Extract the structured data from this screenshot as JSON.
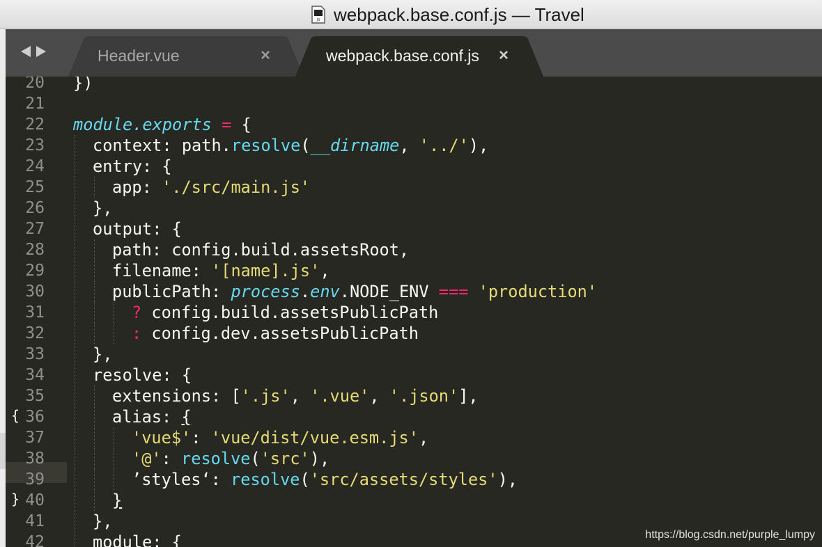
{
  "window": {
    "title": "webpack.base.conf.js — Travel"
  },
  "tabs": [
    {
      "label": "Header.vue",
      "active": false,
      "close": "×"
    },
    {
      "label": "webpack.base.conf.js",
      "active": true,
      "close": "×"
    }
  ],
  "gutter": {
    "line_numbers": [
      "20",
      "21",
      "22",
      "23",
      "24",
      "25",
      "26",
      "27",
      "28",
      "29",
      "30",
      "31",
      "32",
      "33",
      "34",
      "35",
      "36",
      "37",
      "38",
      "39",
      "40",
      "41",
      "42"
    ],
    "fold_markers": {
      "36": "{",
      "40": "}"
    }
  },
  "code": [
    {
      "num": "20",
      "indent": 0,
      "tokens": [
        {
          "t": "})",
          "c": "txt"
        }
      ]
    },
    {
      "num": "21",
      "indent": 0,
      "tokens": []
    },
    {
      "num": "22",
      "indent": 0,
      "tokens": [
        {
          "t": "module.exports",
          "c": "it"
        },
        {
          "t": " ",
          "c": "txt"
        },
        {
          "t": "=",
          "c": "kw"
        },
        {
          "t": " {",
          "c": "txt"
        }
      ]
    },
    {
      "num": "23",
      "indent": 1,
      "tokens": [
        {
          "t": "context: path.",
          "c": "txt"
        },
        {
          "t": "resolve",
          "c": "fn"
        },
        {
          "t": "(",
          "c": "txt"
        },
        {
          "t": "__dirname",
          "c": "it"
        },
        {
          "t": ", ",
          "c": "txt"
        },
        {
          "t": "'../'",
          "c": "str"
        },
        {
          "t": "),",
          "c": "txt"
        }
      ]
    },
    {
      "num": "24",
      "indent": 1,
      "tokens": [
        {
          "t": "entry: {",
          "c": "txt"
        }
      ]
    },
    {
      "num": "25",
      "indent": 2,
      "tokens": [
        {
          "t": "app: ",
          "c": "txt"
        },
        {
          "t": "'./src/main.js'",
          "c": "str"
        }
      ]
    },
    {
      "num": "26",
      "indent": 1,
      "tokens": [
        {
          "t": "},",
          "c": "txt"
        }
      ]
    },
    {
      "num": "27",
      "indent": 1,
      "tokens": [
        {
          "t": "output: {",
          "c": "txt"
        }
      ]
    },
    {
      "num": "28",
      "indent": 2,
      "tokens": [
        {
          "t": "path: config.build.assetsRoot,",
          "c": "txt"
        }
      ]
    },
    {
      "num": "29",
      "indent": 2,
      "tokens": [
        {
          "t": "filename: ",
          "c": "txt"
        },
        {
          "t": "'[name].js'",
          "c": "str"
        },
        {
          "t": ",",
          "c": "txt"
        }
      ]
    },
    {
      "num": "30",
      "indent": 2,
      "tokens": [
        {
          "t": "publicPath: ",
          "c": "txt"
        },
        {
          "t": "process",
          "c": "it"
        },
        {
          "t": ".",
          "c": "txt"
        },
        {
          "t": "env",
          "c": "it"
        },
        {
          "t": ".NODE_ENV ",
          "c": "txt"
        },
        {
          "t": "===",
          "c": "kw"
        },
        {
          "t": " ",
          "c": "txt"
        },
        {
          "t": "'production'",
          "c": "str"
        }
      ]
    },
    {
      "num": "31",
      "indent": 3,
      "tokens": [
        {
          "t": "?",
          "c": "kw"
        },
        {
          "t": " config.build.assetsPublicPath",
          "c": "txt"
        }
      ]
    },
    {
      "num": "32",
      "indent": 3,
      "tokens": [
        {
          "t": ":",
          "c": "kw"
        },
        {
          "t": " config.dev.assetsPublicPath",
          "c": "txt"
        }
      ]
    },
    {
      "num": "33",
      "indent": 1,
      "tokens": [
        {
          "t": "},",
          "c": "txt"
        }
      ]
    },
    {
      "num": "34",
      "indent": 1,
      "tokens": [
        {
          "t": "resolve: {",
          "c": "txt"
        }
      ]
    },
    {
      "num": "35",
      "indent": 2,
      "tokens": [
        {
          "t": "extensions: [",
          "c": "txt"
        },
        {
          "t": "'.js'",
          "c": "str"
        },
        {
          "t": ", ",
          "c": "txt"
        },
        {
          "t": "'.vue'",
          "c": "str"
        },
        {
          "t": ", ",
          "c": "txt"
        },
        {
          "t": "'.json'",
          "c": "str"
        },
        {
          "t": "],",
          "c": "txt"
        }
      ]
    },
    {
      "num": "36",
      "indent": 2,
      "tokens": [
        {
          "t": "alias: ",
          "c": "txt"
        },
        {
          "t": "{",
          "c": "ul"
        }
      ]
    },
    {
      "num": "37",
      "indent": 3,
      "tokens": [
        {
          "t": "'vue$'",
          "c": "str"
        },
        {
          "t": ": ",
          "c": "txt"
        },
        {
          "t": "'vue/dist/vue.esm.js'",
          "c": "str"
        },
        {
          "t": ",",
          "c": "txt"
        }
      ]
    },
    {
      "num": "38",
      "indent": 3,
      "tokens": [
        {
          "t": "'@'",
          "c": "str"
        },
        {
          "t": ": ",
          "c": "txt"
        },
        {
          "t": "resolve",
          "c": "fn"
        },
        {
          "t": "(",
          "c": "txt"
        },
        {
          "t": "'src'",
          "c": "str"
        },
        {
          "t": "),",
          "c": "txt"
        }
      ]
    },
    {
      "num": "39",
      "indent": 3,
      "tokens": [
        {
          "t": "’styles‘: ",
          "c": "txt"
        },
        {
          "t": "resolve",
          "c": "fn"
        },
        {
          "t": "(",
          "c": "txt"
        },
        {
          "t": "'src/assets/styles'",
          "c": "str"
        },
        {
          "t": "),",
          "c": "txt"
        }
      ]
    },
    {
      "num": "40",
      "indent": 2,
      "tokens": [
        {
          "t": "}",
          "c": "ul"
        }
      ]
    },
    {
      "num": "41",
      "indent": 1,
      "tokens": [
        {
          "t": "},",
          "c": "txt"
        }
      ]
    },
    {
      "num": "42",
      "indent": 1,
      "tokens": [
        {
          "t": "module: {",
          "c": "txt"
        }
      ]
    }
  ],
  "watermark": "https://blog.csdn.net/purple_lumpy",
  "colors": {
    "editor_bg": "#272822",
    "tabbar_bg": "#4b4b4b",
    "keyword": "#f92672",
    "string": "#e6db74",
    "function": "#66d9ef",
    "text": "#f8f8f2",
    "gutter_text": "#90908a"
  },
  "icons": [
    "js-file-icon",
    "back-arrow-icon",
    "forward-arrow-icon",
    "close-icon"
  ]
}
